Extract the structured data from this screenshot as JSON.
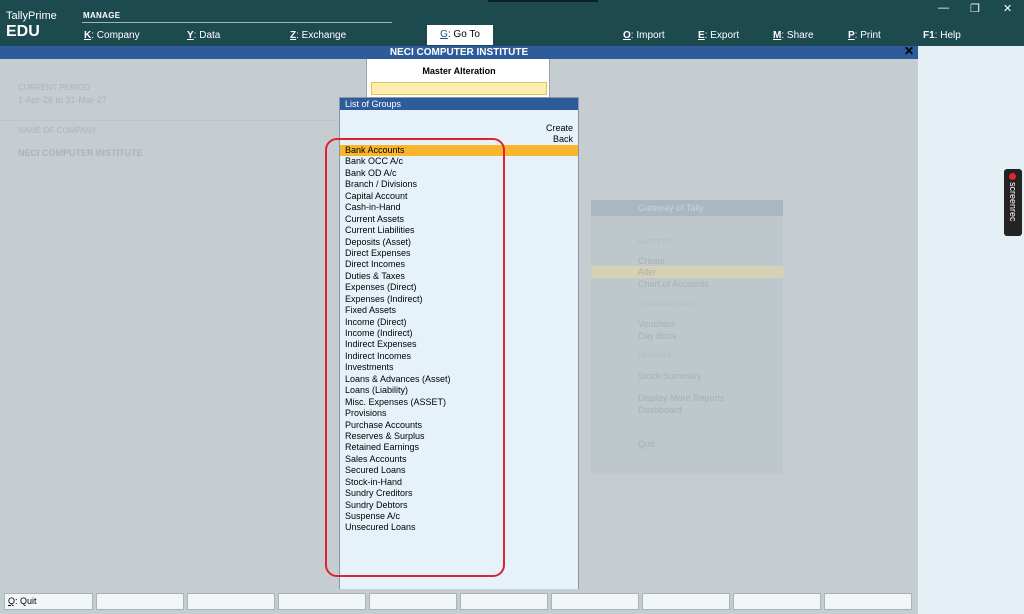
{
  "app": {
    "name": "TallyPrime",
    "edition": "EDU"
  },
  "topbar": {
    "manage_label": "MANAGE",
    "menus": [
      {
        "key": "K",
        "label": "Company"
      },
      {
        "key": "Y",
        "label": "Data"
      },
      {
        "key": "Z",
        "label": "Exchange"
      },
      {
        "key": "G",
        "label": "Go To"
      },
      {
        "key": "O",
        "label": "Import"
      },
      {
        "key": "E",
        "label": "Export"
      },
      {
        "key": "M",
        "label": "Share"
      },
      {
        "key": "P",
        "label": "Print"
      },
      {
        "key": "F1",
        "label": "Help"
      }
    ],
    "window_controls": {
      "minimize": "—",
      "restore": "❐",
      "close": "✕"
    }
  },
  "company_bar": {
    "title": "NECI COMPUTER INSTITUTE",
    "close": "✕"
  },
  "background_info": {
    "period_label": "CURRENT PERIOD",
    "period_value": "1-Apr-26 to 31-Mar-27",
    "company_label": "NAME OF COMPANY",
    "company_value": "NECI COMPUTER INSTITUTE"
  },
  "gateway": {
    "title": "Gateway of Tally",
    "masters_head": "MASTERS",
    "items_masters": [
      "Create",
      "Alter",
      "Chart of Accounts"
    ],
    "transactions_head": "TRANSACTIONS",
    "items_transactions": [
      "Vouchers",
      "Day Book"
    ],
    "reports_head": "REPORTS",
    "items_reports": [
      "Stock Summary",
      "Display More Reports",
      "Dashboard"
    ],
    "quit": "Quit"
  },
  "master_alteration": {
    "title": "Master Alteration",
    "input_value": ""
  },
  "list_of_groups": {
    "title": "List of Groups",
    "actions": {
      "create": "Create",
      "back": "Back"
    },
    "selected_index": 0,
    "items": [
      "Bank Accounts",
      "Bank OCC A/c",
      "Bank OD A/c",
      "Branch / Divisions",
      "Capital Account",
      "Cash-in-Hand",
      "Current Assets",
      "Current Liabilities",
      "Deposits (Asset)",
      "Direct Expenses",
      "Direct Incomes",
      "Duties & Taxes",
      "Expenses (Direct)",
      "Expenses (Indirect)",
      "Fixed Assets",
      "Income (Direct)",
      "Income (Indirect)",
      "Indirect Expenses",
      "Indirect Incomes",
      "Investments",
      "Loans & Advances (Asset)",
      "Loans (Liability)",
      "Misc. Expenses (ASSET)",
      "Provisions",
      "Purchase Accounts",
      "Reserves & Surplus",
      "Retained Earnings",
      "Sales Accounts",
      "Secured Loans",
      "Stock-in-Hand",
      "Sundry Creditors",
      "Sundry Debtors",
      "Suspense A/c",
      "Unsecured Loans"
    ]
  },
  "overlay": {
    "screenrec_label": "screenrec"
  },
  "bottombar": {
    "quit_key": "Q",
    "quit_label": "Quit"
  },
  "colors": {
    "header_bg": "#1d4a4e",
    "title_bar": "#2e5b9a",
    "selection": "#f9b52b",
    "annotation": "#e02230"
  }
}
